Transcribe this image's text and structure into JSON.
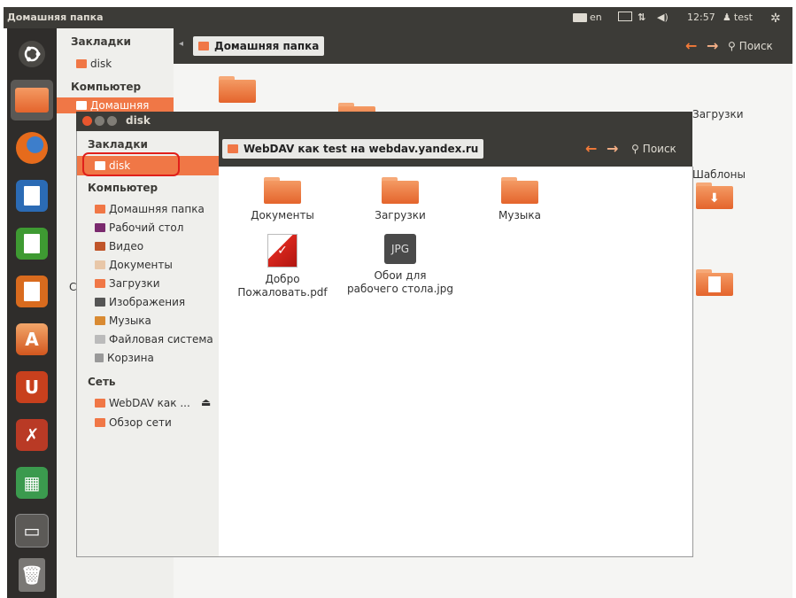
{
  "top_panel": {
    "title": "Домашняя папка",
    "keyboard_layout": "en",
    "time": "12:57",
    "user": "test"
  },
  "back_window": {
    "sidebar": {
      "bookmarks_heading": "Закладки",
      "bookmark_disk": "disk",
      "computer_heading": "Компьютер",
      "home_item": "Домашняя"
    },
    "breadcrumb": "Домашняя папка",
    "search_label": "Поиск",
    "folders": [
      {
        "label": "Загрузки"
      },
      {
        "label": "Шаблоны"
      }
    ]
  },
  "front_window": {
    "title": "disk",
    "breadcrumb": "WebDAV как test на webdav.yandex.ru",
    "search_label": "Поиск",
    "sidebar": {
      "bookmarks_heading": "Закладки",
      "bookmark_disk": "disk",
      "computer_heading": "Компьютер",
      "computer_items": [
        "Домашняя папка",
        "Рабочий стол",
        "Видео",
        "Документы",
        "Загрузки",
        "Изображения",
        "Музыка",
        "Файловая система",
        "Корзина"
      ],
      "network_heading": "Сеть",
      "network_items": [
        "WebDAV как ...",
        "Обзор сети"
      ]
    },
    "files": [
      {
        "label": "Документы"
      },
      {
        "label": "Загрузки"
      },
      {
        "label": "Музыка"
      },
      {
        "label_line1": "Добро",
        "label_line2": "Пожаловать.pdf"
      },
      {
        "label_line1": "Обои для",
        "label_line2": "рабочего стола.jpg",
        "badge": "JPG"
      }
    ]
  },
  "colors": {
    "accent": "#f07746",
    "panel": "#3c3b37",
    "highlight_outline": "#e0201b"
  }
}
